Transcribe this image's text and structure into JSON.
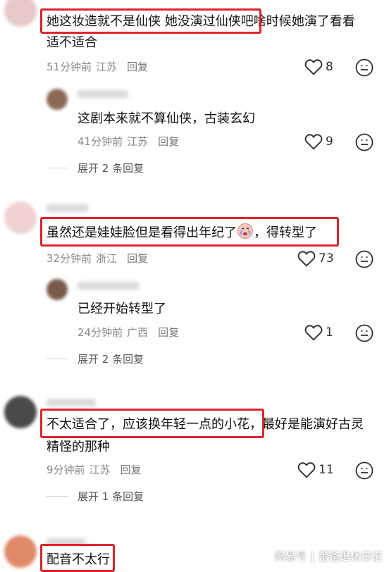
{
  "comments": [
    {
      "text_hl": "她这妆造就不是仙侠 她没演过仙侠吧",
      "text_rest": "啥时候她演了看看",
      "text_line2": "适不适合",
      "time": "51分钟前",
      "location": "江苏",
      "reply_label": "回复",
      "likes": "8",
      "avatar_color": "#e8c9c9",
      "reply": {
        "text": "这剧本来就不算仙侠，古装玄幻",
        "time": "41分钟前",
        "location": "江苏",
        "reply_label": "回复",
        "likes": "9",
        "avatar_color": "#8a6a55"
      },
      "expand": "展开 2 条回复"
    },
    {
      "text_hl_a": "虽然还是娃娃脸但是看得出年纪了",
      "text_hl_b": "，得转型了",
      "emoji": "crying-face-emoji",
      "time": "32分钟前",
      "location": "浙江",
      "reply_label": "回复",
      "likes": "73",
      "avatar_color": "#f0d2d2",
      "reply": {
        "text": "已经开始转型了",
        "time": "24分钟前",
        "location": "广西",
        "reply_label": "回复",
        "likes": "1",
        "avatar_color": "#7a5a4a"
      },
      "expand": "展开 2 条回复"
    },
    {
      "text_hl": "不太适合了，应该换年轻一点的小花",
      "text_rest": "，最好是能演好古灵",
      "text_line2": "精怪的那种",
      "time": "9分钟前",
      "location": "江苏",
      "reply_label": "回复",
      "likes": "11",
      "avatar_color": "#4a4a4a",
      "expand": "展开 1 条回复"
    },
    {
      "text_hl": "配音不太行",
      "avatar_color": "#e08a6a"
    }
  ],
  "watermark": {
    "left": "网易号",
    "right": "蕾爸退休日记"
  }
}
